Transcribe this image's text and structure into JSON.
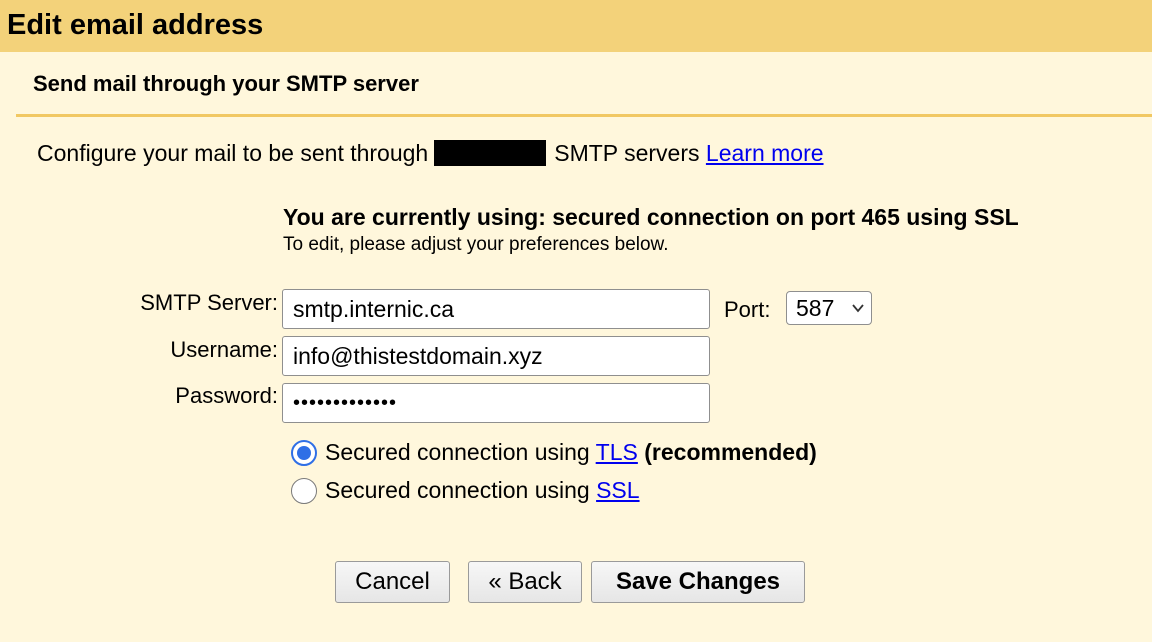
{
  "dialog": {
    "title": "Edit email address",
    "subtitle": "Send mail through your SMTP server"
  },
  "intro": {
    "prefix": "Configure your mail to be sent through",
    "suffix": "SMTP servers",
    "learn_more": "Learn more"
  },
  "status": {
    "current": "You are currently using: secured connection on port 465 using SSL",
    "hint": "To edit, please adjust your preferences below."
  },
  "form": {
    "smtp_label": "SMTP Server:",
    "smtp_value": "smtp.internic.ca",
    "port_label": "Port:",
    "port_value": "587",
    "username_label": "Username:",
    "username_value": "info@thistestdomain.xyz",
    "password_label": "Password:",
    "password_value": "•••••••••••••"
  },
  "security": {
    "tls_text": "Secured connection using",
    "tls_link": "TLS",
    "tls_note": "(recommended)",
    "tls_selected": true,
    "ssl_text": "Secured connection using",
    "ssl_link": "SSL",
    "ssl_selected": false
  },
  "buttons": {
    "cancel": "Cancel",
    "back": "« Back",
    "save": "Save Changes"
  },
  "colors": {
    "title_bar": "#f3d27a",
    "background": "#fff7dc",
    "divider": "#f1c863",
    "link": "#0000ee",
    "radio_accent": "#2f6fe6"
  }
}
